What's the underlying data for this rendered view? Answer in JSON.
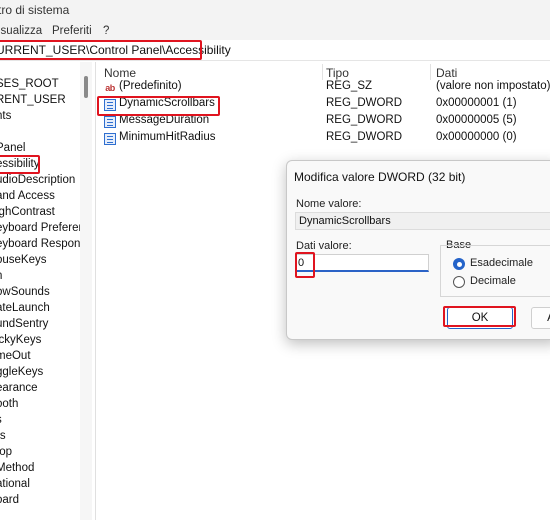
{
  "window": {
    "title": "tro di sistema"
  },
  "menu": [
    "isualizza",
    "Preferiti",
    "?"
  ],
  "address": {
    "path": "URRENT_USER\\Control Panel\\Accessibility"
  },
  "tree": {
    "items": [
      "SES_ROOT",
      "RENT_USER",
      "nts",
      "",
      "Panel",
      "essibility",
      "udioDescription",
      "and Access",
      "ighContrast",
      "eyboard Preferen",
      "eyboard Respons",
      "ouseKeys",
      "n",
      "owSounds",
      "ateLaunch",
      "undSentry",
      "ickyKeys",
      "meOut",
      "ggleKeys",
      "earance",
      "ooth",
      "s",
      "rs",
      "top",
      "Method",
      "ational",
      "oard"
    ]
  },
  "list": {
    "columns": {
      "name": "Nome",
      "type": "Tipo",
      "data": "Dati"
    },
    "rows": [
      {
        "icon": "string-value-icon",
        "name": "(Predefinito)",
        "type": "REG_SZ",
        "data": "(valore non impostato)"
      },
      {
        "icon": "binary-value-icon",
        "name": "DynamicScrollbars",
        "type": "REG_DWORD",
        "data": "0x00000001 (1)"
      },
      {
        "icon": "binary-value-icon",
        "name": "MessageDuration",
        "type": "REG_DWORD",
        "data": "0x00000005 (5)"
      },
      {
        "icon": "binary-value-icon",
        "name": "MinimumHitRadius",
        "type": "REG_DWORD",
        "data": "0x00000000 (0)"
      }
    ]
  },
  "dialog": {
    "title": "Modifica valore DWORD (32 bit)",
    "name_label": "Nome valore:",
    "name_value": "DynamicScrollbars",
    "data_label": "Dati valore:",
    "data_value": "0",
    "base_label": "Base",
    "radio_hex": "Esadecimale",
    "radio_dec": "Decimale",
    "ok_label": "OK",
    "cancel_label": "A"
  },
  "colors": {
    "highlight": "#e0141f",
    "accent": "#2463c9"
  }
}
